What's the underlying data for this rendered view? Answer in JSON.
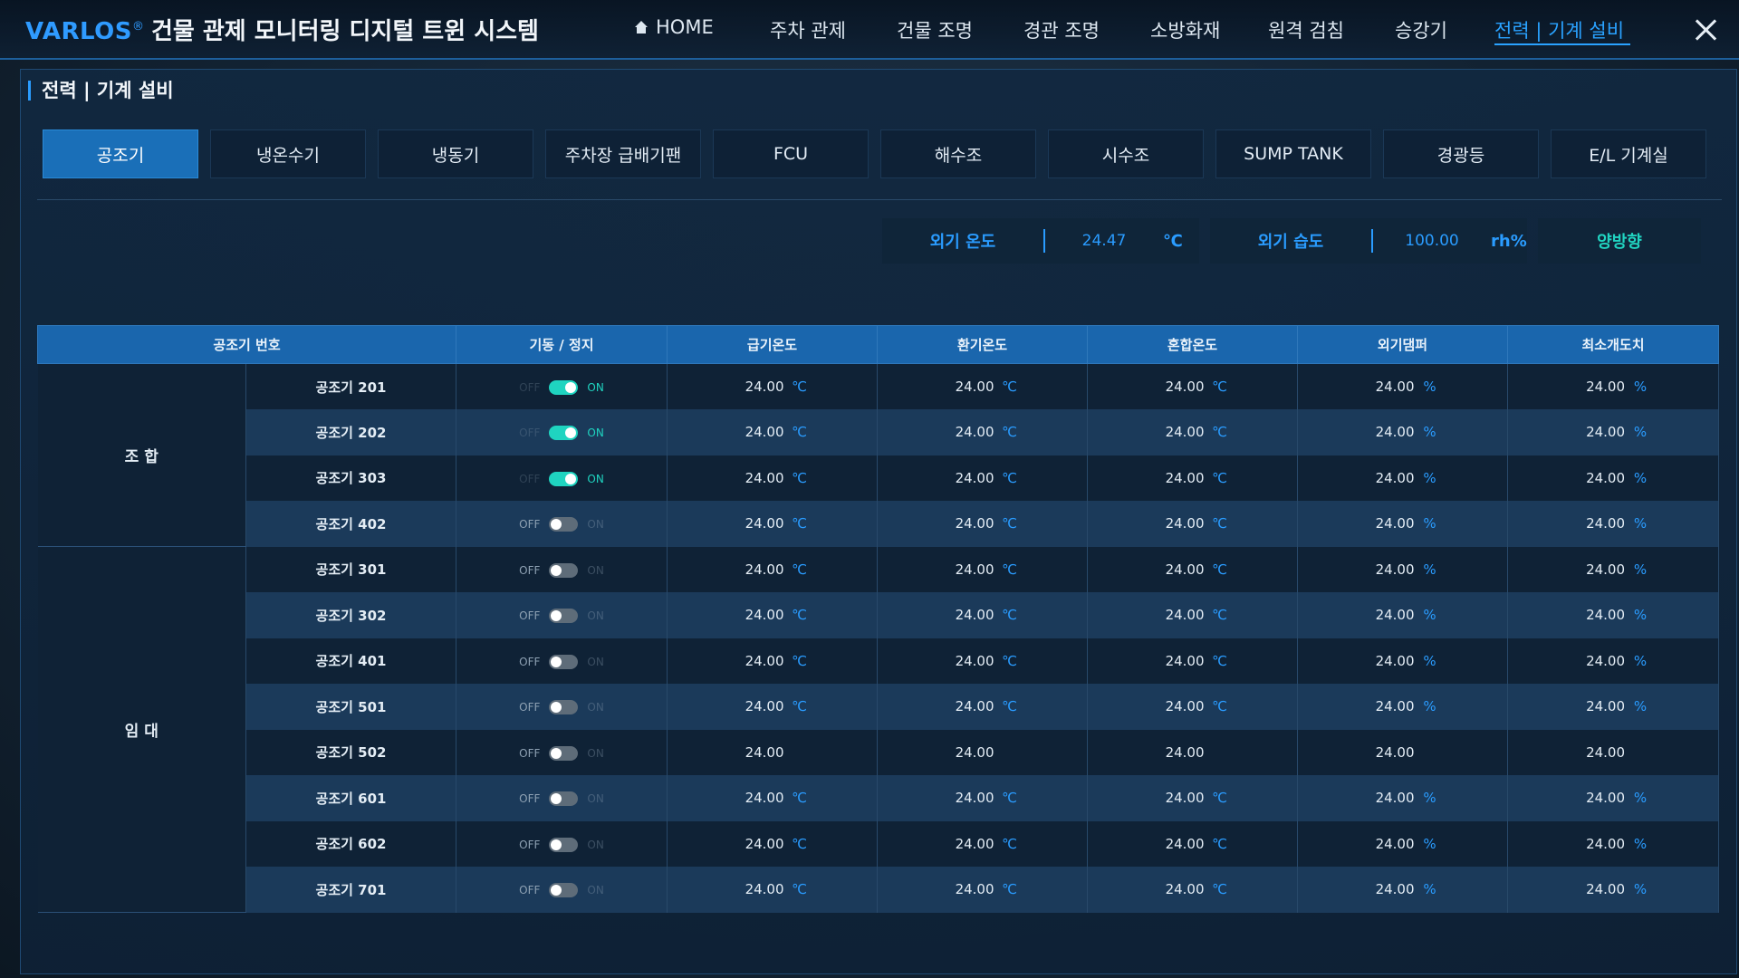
{
  "header": {
    "logo": "VARLOS",
    "logo_reg": "®",
    "title": "건물 관제 모니터링 디지털 트윈 시스템",
    "nav": [
      "HOME",
      "주차 관제",
      "건물 조명",
      "경관 조명",
      "소방화재",
      "원격 검침",
      "승강기",
      "전력 | 기계 설비"
    ],
    "active_nav": "전력 | 기계 설비"
  },
  "page": {
    "title": "전력 | 기계 설비",
    "tabs": [
      "공조기",
      "냉온수기",
      "냉동기",
      "주차장 급배기팬",
      "FCU",
      "해수조",
      "시수조",
      "SUMP TANK",
      "경광등",
      "E/L 기계실"
    ],
    "active_tab": "공조기"
  },
  "weather": {
    "temp_label": "외기 온도",
    "temp_value": "24.47",
    "temp_unit": "℃",
    "humidity_label": "외기 습도",
    "humidity_value": "100.00",
    "humidity_unit": "rh%",
    "direction": "양방향"
  },
  "table": {
    "headers": [
      "공조기 번호",
      "기동 / 정지",
      "급기온도",
      "환기온도",
      "혼합온도",
      "외기댐퍼",
      "최소개도치"
    ],
    "off_label": "OFF",
    "on_label": "ON",
    "groups": [
      {
        "name": "조 합",
        "rows": [
          {
            "unit": "공조기 201",
            "on": true,
            "supply": "24.00",
            "return": "24.00",
            "mix": "24.00",
            "damper": "24.00",
            "min_open": "24.00"
          },
          {
            "unit": "공조기 202",
            "on": true,
            "supply": "24.00",
            "return": "24.00",
            "mix": "24.00",
            "damper": "24.00",
            "min_open": "24.00"
          },
          {
            "unit": "공조기 303",
            "on": true,
            "supply": "24.00",
            "return": "24.00",
            "mix": "24.00",
            "damper": "24.00",
            "min_open": "24.00"
          },
          {
            "unit": "공조기 402",
            "on": false,
            "supply": "24.00",
            "return": "24.00",
            "mix": "24.00",
            "damper": "24.00",
            "min_open": "24.00"
          }
        ]
      },
      {
        "name": "임 대",
        "rows": [
          {
            "unit": "공조기 301",
            "on": false,
            "supply": "24.00",
            "return": "24.00",
            "mix": "24.00",
            "damper": "24.00",
            "min_open": "24.00"
          },
          {
            "unit": "공조기 302",
            "on": false,
            "supply": "24.00",
            "return": "24.00",
            "mix": "24.00",
            "damper": "24.00",
            "min_open": "24.00"
          },
          {
            "unit": "공조기 401",
            "on": false,
            "supply": "24.00",
            "return": "24.00",
            "mix": "24.00",
            "damper": "24.00",
            "min_open": "24.00"
          },
          {
            "unit": "공조기 501",
            "on": false,
            "supply": "24.00",
            "return": "24.00",
            "mix": "24.00",
            "damper": "24.00",
            "min_open": "24.00"
          },
          {
            "unit": "공조기 502",
            "on": false,
            "supply": "24.00",
            "return": "24.00",
            "mix": "24.00",
            "damper": "24.00",
            "min_open": "24.00",
            "units_hidden": true
          },
          {
            "unit": "공조기 601",
            "on": false,
            "supply": "24.00",
            "return": "24.00",
            "mix": "24.00",
            "damper": "24.00",
            "min_open": "24.00"
          },
          {
            "unit": "공조기 602",
            "on": false,
            "supply": "24.00",
            "return": "24.00",
            "mix": "24.00",
            "damper": "24.00",
            "min_open": "24.00"
          },
          {
            "unit": "공조기 701",
            "on": false,
            "supply": "24.00",
            "return": "24.00",
            "mix": "24.00",
            "damper": "24.00",
            "min_open": "24.00"
          }
        ]
      }
    ],
    "temp_unit": "℃",
    "pct_unit": "%"
  },
  "colors": {
    "accent": "#2a9cff",
    "on": "#1fd4c0",
    "header_bg": "#1a66ad"
  }
}
